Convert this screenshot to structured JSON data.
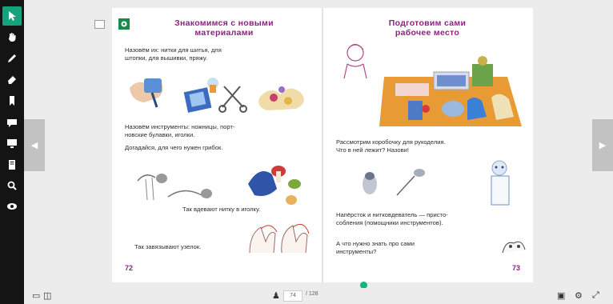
{
  "toolbar": {
    "tools": [
      {
        "name": "select-tool",
        "icon": "cursor-icon"
      },
      {
        "name": "pan-tool",
        "icon": "hand-icon"
      },
      {
        "name": "pen-tool",
        "icon": "pen-icon"
      },
      {
        "name": "eraser-tool",
        "icon": "eraser-icon"
      },
      {
        "name": "bookmark-tool",
        "icon": "bookmark-icon"
      },
      {
        "name": "comment-tool",
        "icon": "comment-icon"
      },
      {
        "name": "screen-tool",
        "icon": "screen-icon"
      },
      {
        "name": "notes-tool",
        "icon": "notes-icon"
      },
      {
        "name": "search-tool",
        "icon": "search-icon"
      },
      {
        "name": "view-tool",
        "icon": "eye-icon"
      }
    ]
  },
  "left_page": {
    "title": "Знакомимся с новыми\nматериалами",
    "p1": "Назовём их: нитки для шитья, для\nштопки, для вышивки, пряжу.",
    "p2": "Назовём инструменты: ножницы, порт-\nновские булавки, иголки.",
    "p3": "Догадайся, для чего нужен грибок.",
    "p4": "Так вдевают нитку в иголку.",
    "p5": "Так завязывают узелок.",
    "page_number": "72"
  },
  "right_page": {
    "title": "Подготовим сами\nрабочее место",
    "p1": "Рассмотрим коробочку для рукоделия.\nЧто в ней лежит? Назови!",
    "p2": "Напёрсток и нитковдеватель — присто-\nсобления (помощники инструментов).",
    "p3": "А что нужно знать про сами\nинструменты?",
    "page_number": "73"
  },
  "bottom_bar": {
    "current_page": "74",
    "total_pages": "/ 128"
  }
}
